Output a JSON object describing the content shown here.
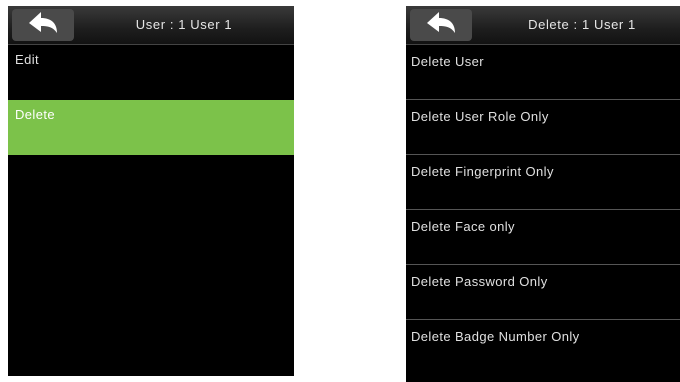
{
  "left": {
    "header": {
      "title": "User : 1 User 1",
      "back_icon": "back-arrow-icon"
    },
    "menu": [
      {
        "label": "Edit",
        "selected": false
      },
      {
        "label": "Delete",
        "selected": true
      }
    ],
    "accent": "#7cc24a"
  },
  "right": {
    "header": {
      "title": "Delete : 1 User 1",
      "back_icon": "back-arrow-icon"
    },
    "menu": [
      {
        "label": "Delete User"
      },
      {
        "label": "Delete User Role Only"
      },
      {
        "label": "Delete Fingerprint Only"
      },
      {
        "label": "Delete Face only"
      },
      {
        "label": "Delete Password Only"
      },
      {
        "label": "Delete Badge Number Only"
      }
    ]
  }
}
